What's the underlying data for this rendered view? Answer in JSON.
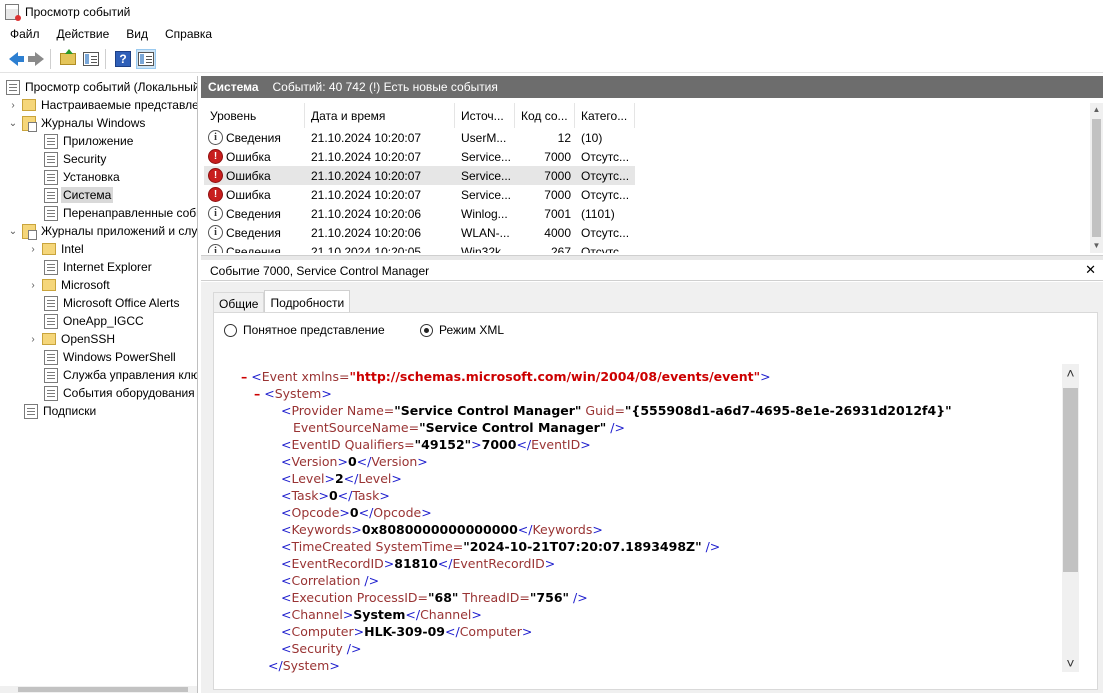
{
  "window": {
    "title": "Просмотр событий"
  },
  "menu": [
    "Файл",
    "Действие",
    "Вид",
    "Справка"
  ],
  "toolbar": {
    "icons": [
      "back-arrow-icon",
      "forward-arrow-icon",
      "folder-up-icon",
      "show-hide-tree-icon",
      "help-icon",
      "show-hide-action-pane-icon"
    ]
  },
  "tree": {
    "root": "Просмотр событий (Локальный)",
    "custom_views": "Настраиваемые представления",
    "windows_logs": "Журналы Windows",
    "app": "Приложение",
    "security": "Security",
    "setup": "Установка",
    "system": "Система",
    "forwarded": "Перенаправленные события",
    "apps_services": "Журналы приложений и служб",
    "intel": "Intel",
    "ie": "Internet Explorer",
    "microsoft": "Microsoft",
    "office_alerts": "Microsoft Office Alerts",
    "oneapp": "OneApp_IGCC",
    "openssh": "OpenSSH",
    "powershell": "Windows PowerShell",
    "key_mgmt": "Служба управления ключами",
    "hardware": "События оборудования",
    "subscriptions": "Подписки"
  },
  "list_header": {
    "name": "Система",
    "info": "Событий: 40 742 (!) Есть новые события"
  },
  "columns": [
    "Уровень",
    "Дата и время",
    "Источ...",
    "Код со...",
    "Катего..."
  ],
  "events": [
    {
      "level": "Сведения",
      "type": "info",
      "date": "21.10.2024 10:20:07",
      "source": "UserM...",
      "code": "12",
      "cat": "(10)"
    },
    {
      "level": "Ошибка",
      "type": "error",
      "date": "21.10.2024 10:20:07",
      "source": "Service...",
      "code": "7000",
      "cat": "Отсутс..."
    },
    {
      "level": "Ошибка",
      "type": "error",
      "date": "21.10.2024 10:20:07",
      "source": "Service...",
      "code": "7000",
      "cat": "Отсутс..."
    },
    {
      "level": "Ошибка",
      "type": "error",
      "date": "21.10.2024 10:20:07",
      "source": "Service...",
      "code": "7000",
      "cat": "Отсутс..."
    },
    {
      "level": "Сведения",
      "type": "info",
      "date": "21.10.2024 10:20:06",
      "source": "Winlog...",
      "code": "7001",
      "cat": "(1101)"
    },
    {
      "level": "Сведения",
      "type": "info",
      "date": "21.10.2024 10:20:06",
      "source": "WLAN-...",
      "code": "4000",
      "cat": "Отсутс..."
    },
    {
      "level": "Сведения",
      "type": "info",
      "date": "21.10.2024 10:20:05",
      "source": "Win32k",
      "code": "267",
      "cat": "Отсутс..."
    }
  ],
  "detail": {
    "title": "Событие 7000, Service Control Manager",
    "close": "✕",
    "tabs": [
      "Общие",
      "Подробности"
    ],
    "radio_friendly": "Понятное представление",
    "radio_xml": "Режим XML"
  },
  "xml": {
    "minus": "–",
    "event_open": "Event",
    "xmlns_attr": " xmlns=",
    "xmlns_val": "\"http://schemas.microsoft.com/win/2004/08/events/event\"",
    "system": "System",
    "provider": "Provider",
    "name_attr": " Name=",
    "provider_name": "\"Service Control Manager\"",
    "guid_attr": " Guid=",
    "guid_val": "\"{555908d1-a6d7-4695-8e1e-26931d2012f4}\"",
    "esn_attr": "EventSourceName=",
    "esn_val": "\"Service Control Manager\"",
    "eventid": "EventID",
    "qualifiers_attr": " Qualifiers=",
    "qualifiers_val": "\"49152\"",
    "eventid_val": "7000",
    "version": "Version",
    "version_val": "0",
    "level": "Level",
    "level_val": "2",
    "task": "Task",
    "task_val": "0",
    "opcode": "Opcode",
    "opcode_val": "0",
    "keywords": "Keywords",
    "keywords_val": "0x8080000000000000",
    "timecreated": "TimeCreated",
    "systemtime_attr": " SystemTime=",
    "systemtime_val": "\"2024-10-21T07:20:07.1893498Z\"",
    "recordid": "EventRecordID",
    "recordid_val": "81810",
    "correlation": "Correlation",
    "execution": "Execution",
    "processid_attr": " ProcessID=",
    "processid_val": "\"68\"",
    "threadid_attr": " ThreadID=",
    "threadid_val": "\"756\"",
    "channel": "Channel",
    "channel_val": "System",
    "computer": "Computer",
    "computer_val": "HLK-309-09",
    "security": "Security"
  }
}
